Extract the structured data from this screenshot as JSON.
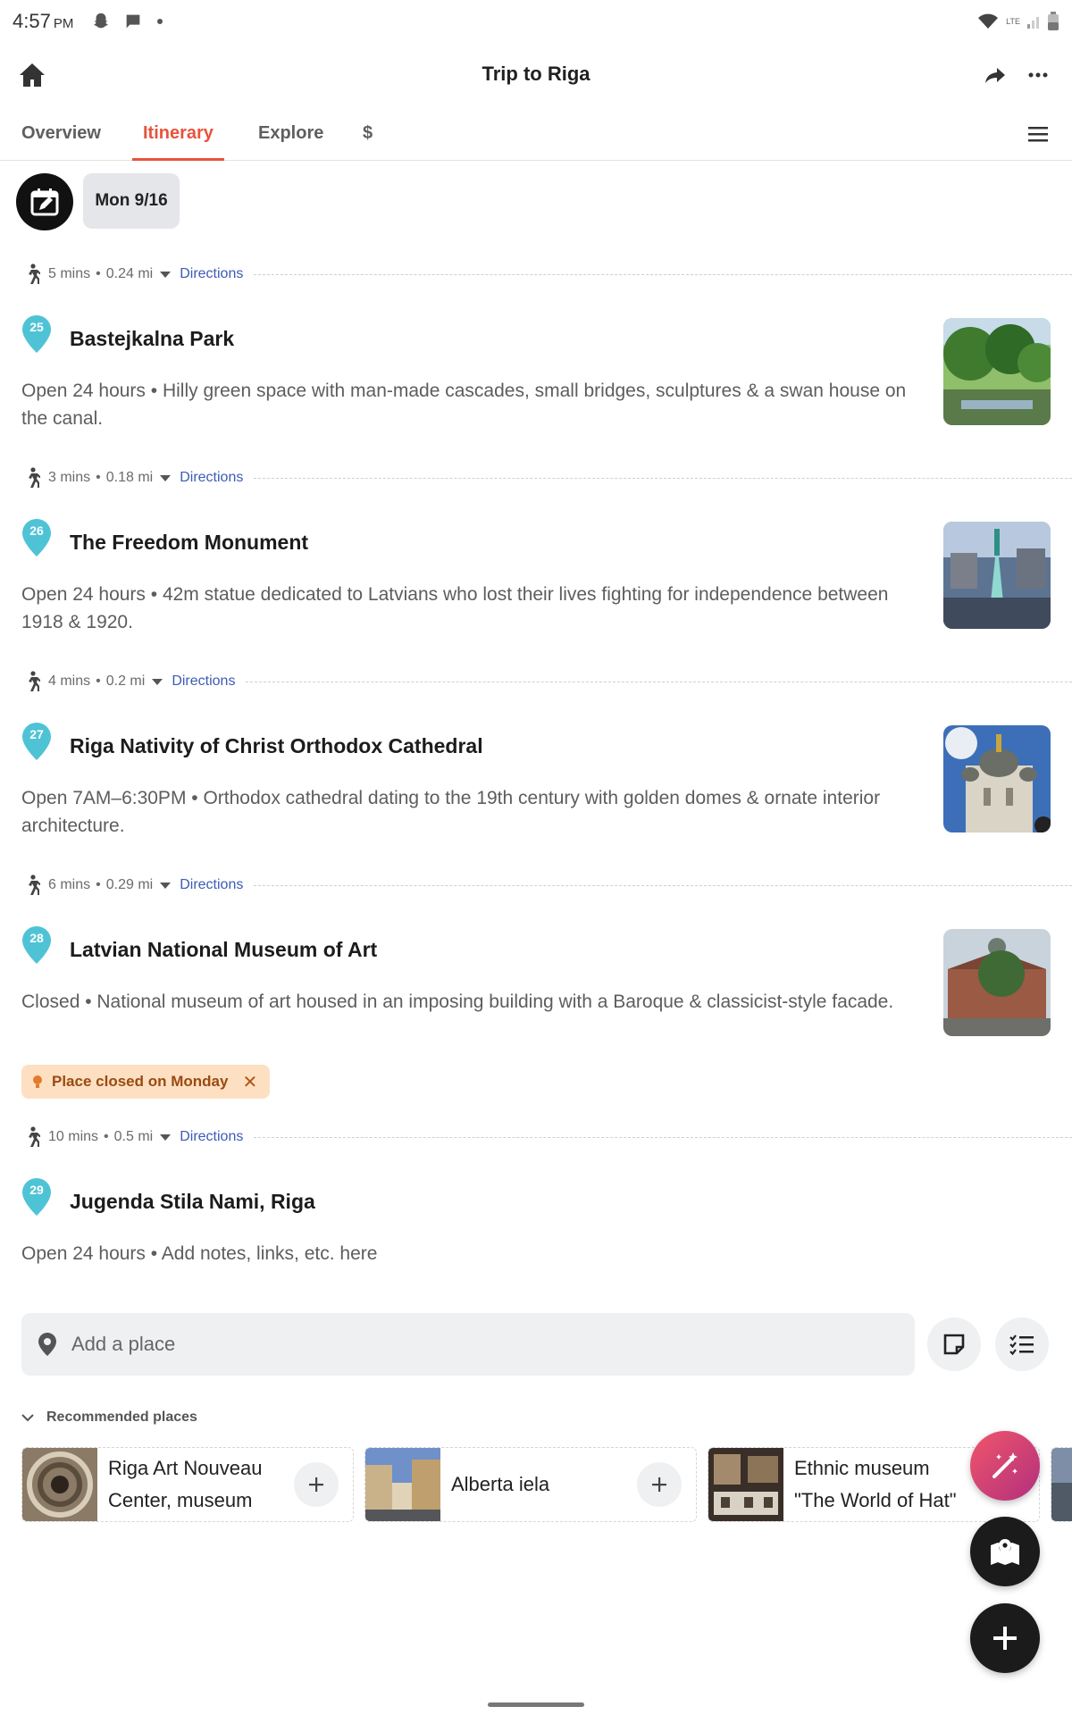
{
  "status_bar": {
    "time": "4:57",
    "ampm": "PM",
    "network": "LTE"
  },
  "header": {
    "title": "Trip to Riga"
  },
  "tabs": [
    {
      "label": "Overview"
    },
    {
      "label": "Itinerary"
    },
    {
      "label": "Explore"
    },
    {
      "label": "$"
    }
  ],
  "date_chip": "Mon 9/16",
  "travel": [
    {
      "time": "5 mins",
      "distance": "0.24 mi",
      "link": "Directions"
    },
    {
      "time": "3 mins",
      "distance": "0.18 mi",
      "link": "Directions"
    },
    {
      "time": "4 mins",
      "distance": "0.2 mi",
      "link": "Directions"
    },
    {
      "time": "6 mins",
      "distance": "0.29 mi",
      "link": "Directions"
    },
    {
      "time": "10 mins",
      "distance": "0.5 mi",
      "link": "Directions"
    }
  ],
  "places": [
    {
      "number": "25",
      "name": "Bastejkalna Park",
      "description": "Open 24 hours • Hilly green space with man-made cascades, small bridges, sculptures & a swan house on the canal."
    },
    {
      "number": "26",
      "name": "The Freedom Monument",
      "description": "Open 24 hours • 42m statue dedicated to Latvians who lost their lives fighting for independence between 1918 & 1920."
    },
    {
      "number": "27",
      "name": "Riga Nativity of Christ Orthodox Cathedral",
      "description": "Open 7AM–6:30PM • Orthodox cathedral dating to the 19th century with golden domes & ornate interior architecture."
    },
    {
      "number": "28",
      "name": "Latvian National Museum of Art",
      "description": "Closed • National museum of art housed in an imposing building with a Baroque & classicist-style facade."
    },
    {
      "number": "29",
      "name": "Jugenda Stila Nami, Riga",
      "description": "Open 24 hours • Add notes, links, etc. here"
    }
  ],
  "closed_badge": "Place closed on Monday",
  "add_place": {
    "placeholder": "Add a place"
  },
  "recommended": {
    "header": "Recommended places",
    "items": [
      {
        "line1": "Riga Art Nouveau",
        "line2": "Center, museum"
      },
      {
        "line1": "Alberta iela",
        "line2": ""
      },
      {
        "line1": "Ethnic museum",
        "line2": "\"The World of Hat\""
      }
    ]
  },
  "colors": {
    "accent": "#e8533c",
    "pin": "#4fc3d6",
    "link": "#3b5bb5"
  }
}
